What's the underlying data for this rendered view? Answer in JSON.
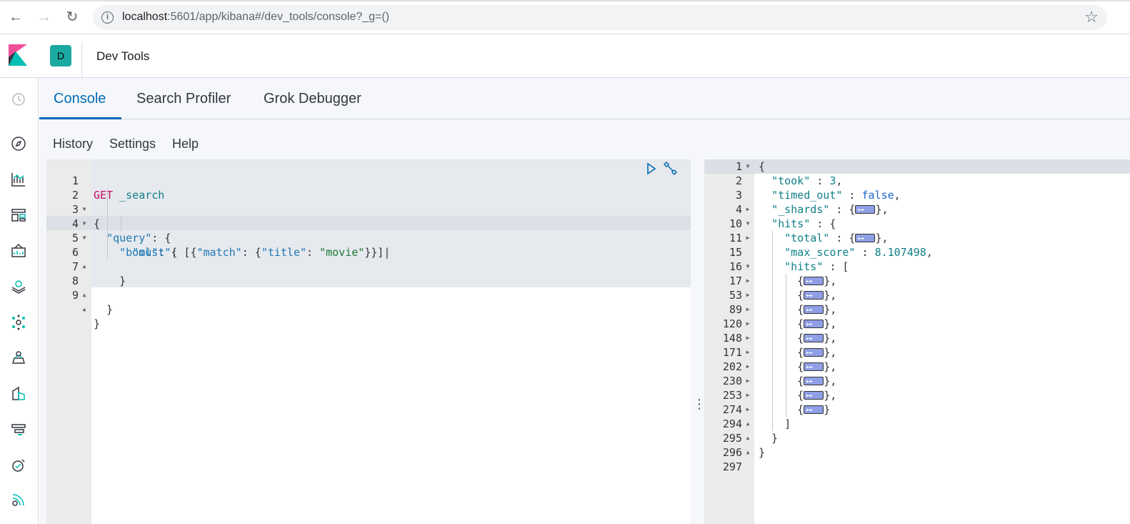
{
  "browser": {
    "url_host": "localhost",
    "url_rest": ":5601/app/kibana#/dev_tools/console?_g=()"
  },
  "header": {
    "space_initial": "D",
    "app_title": "Dev Tools"
  },
  "tabs": [
    {
      "label": "Console"
    },
    {
      "label": "Search Profiler"
    },
    {
      "label": "Grok Debugger"
    }
  ],
  "submenu": {
    "history": "History",
    "settings": "Settings",
    "help": "Help"
  },
  "request": {
    "method": "GET",
    "endpoint": "_search",
    "line_numbers": [
      "1",
      "2",
      "3",
      "4",
      "5",
      "6",
      "7",
      "8",
      "9"
    ]
  },
  "response": {
    "line_numbers": [
      "1",
      "2",
      "3",
      "4",
      "10",
      "11",
      "15",
      "16",
      "17",
      "53",
      "89",
      "120",
      "148",
      "171",
      "202",
      "230",
      "253",
      "274",
      "294",
      "295",
      "296",
      "297"
    ],
    "took": "3",
    "timed_out": "false",
    "max_score": "8.107498"
  }
}
